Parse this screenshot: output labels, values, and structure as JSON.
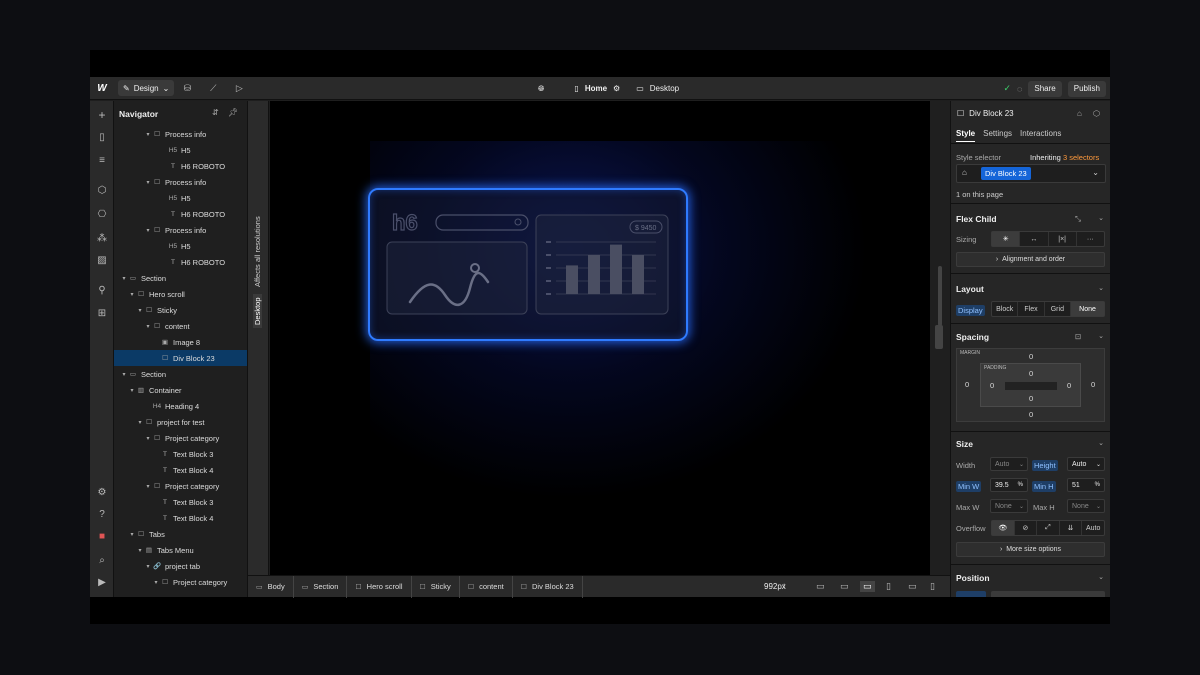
{
  "topbar": {
    "logo": "W",
    "mode_label": "Design",
    "page_name": "Home",
    "breakpoint_label": "Desktop",
    "share_label": "Share",
    "publish_label": "Publish",
    "status_color": "#3ccf6b"
  },
  "navigator": {
    "title": "Navigator",
    "rows": [
      {
        "label": "Process info",
        "icon": "box-icon",
        "icon_char": "☐",
        "depth": 3,
        "caret": "▾"
      },
      {
        "label": "H5",
        "icon": "h5-icon",
        "icon_char": "H5",
        "depth": 5,
        "caret": ""
      },
      {
        "label": "H6 ROBOTO",
        "icon": "text-icon",
        "icon_char": "T",
        "depth": 5,
        "caret": ""
      },
      {
        "label": "Process info",
        "icon": "box-icon",
        "icon_char": "☐",
        "depth": 3,
        "caret": "▾"
      },
      {
        "label": "H5",
        "icon": "h5-icon",
        "icon_char": "H5",
        "depth": 5,
        "caret": ""
      },
      {
        "label": "H6 ROBOTO",
        "icon": "text-icon",
        "icon_char": "T",
        "depth": 5,
        "caret": ""
      },
      {
        "label": "Process info",
        "icon": "box-icon",
        "icon_char": "☐",
        "depth": 3,
        "caret": "▾"
      },
      {
        "label": "H5",
        "icon": "h5-icon",
        "icon_char": "H5",
        "depth": 5,
        "caret": ""
      },
      {
        "label": "H6 ROBOTO",
        "icon": "text-icon",
        "icon_char": "T",
        "depth": 5,
        "caret": ""
      },
      {
        "label": "Section",
        "icon": "section-icon",
        "icon_char": "▭",
        "depth": 0,
        "caret": "▾"
      },
      {
        "label": "Hero scroll",
        "icon": "box-icon",
        "icon_char": "☐",
        "depth": 1,
        "caret": "▾"
      },
      {
        "label": "Sticky",
        "icon": "box-icon",
        "icon_char": "☐",
        "depth": 2,
        "caret": "▾"
      },
      {
        "label": "content",
        "icon": "box-icon",
        "icon_char": "☐",
        "depth": 3,
        "caret": "▾"
      },
      {
        "label": "Image 8",
        "icon": "image-icon",
        "icon_char": "▣",
        "depth": 4,
        "caret": ""
      },
      {
        "label": "Div Block 23",
        "icon": "box-icon",
        "icon_char": "☐",
        "depth": 4,
        "caret": "",
        "selected": true
      },
      {
        "label": "Section",
        "icon": "section-icon",
        "icon_char": "▭",
        "depth": 0,
        "caret": "▾"
      },
      {
        "label": "Container",
        "icon": "container-icon",
        "icon_char": "▥",
        "depth": 1,
        "caret": "▾"
      },
      {
        "label": "Heading 4",
        "icon": "h4-icon",
        "icon_char": "H4",
        "depth": 3,
        "caret": ""
      },
      {
        "label": "project for test",
        "icon": "box-icon",
        "icon_char": "☐",
        "depth": 2,
        "caret": "▾"
      },
      {
        "label": "Project category",
        "icon": "box-icon",
        "icon_char": "☐",
        "depth": 3,
        "caret": "▾"
      },
      {
        "label": "Text Block 3",
        "icon": "text-icon",
        "icon_char": "T",
        "depth": 4,
        "caret": ""
      },
      {
        "label": "Text Block 4",
        "icon": "text-icon",
        "icon_char": "T",
        "depth": 4,
        "caret": ""
      },
      {
        "label": "Project category",
        "icon": "box-icon",
        "icon_char": "☐",
        "depth": 3,
        "caret": "▾"
      },
      {
        "label": "Text Block 3",
        "icon": "text-icon",
        "icon_char": "T",
        "depth": 4,
        "caret": ""
      },
      {
        "label": "Text Block 4",
        "icon": "text-icon",
        "icon_char": "T",
        "depth": 4,
        "caret": ""
      },
      {
        "label": "Tabs",
        "icon": "tabs-icon",
        "icon_char": "☐",
        "depth": 1,
        "caret": "▾"
      },
      {
        "label": "Tabs Menu",
        "icon": "tabs-menu-icon",
        "icon_char": "▤",
        "depth": 2,
        "caret": "▾"
      },
      {
        "label": "project tab",
        "icon": "link-icon",
        "icon_char": "🔗",
        "depth": 3,
        "caret": "▾"
      },
      {
        "label": "Project category",
        "icon": "box-icon",
        "icon_char": "☐",
        "depth": 4,
        "caret": "▾"
      }
    ]
  },
  "vstrip": {
    "affects_label": "Affects all resolutions",
    "desktop_label": "Desktop"
  },
  "canvas": {
    "card": {
      "heading": "h6",
      "price": "$ 9450",
      "bar_values": [
        0.55,
        0.75,
        0.95,
        0.75
      ],
      "accent_color": "#2f7bff"
    }
  },
  "breadcrumbs": {
    "items": [
      {
        "label": "Body",
        "icon": "body-icon"
      },
      {
        "label": "Section",
        "icon": "section-icon"
      },
      {
        "label": "Hero scroll",
        "icon": "box-icon"
      },
      {
        "label": "Sticky",
        "icon": "box-icon"
      },
      {
        "label": "content",
        "icon": "box-icon"
      },
      {
        "label": "Div Block 23",
        "icon": "box-icon"
      }
    ],
    "width_label": "992px"
  },
  "panel": {
    "element_name": "Div Block 23",
    "tabs": [
      "Style",
      "Settings",
      "Interactions"
    ],
    "style_selector_label": "Style selector",
    "inheriting_prefix": "Inheriting",
    "inheriting_count": "3 selectors",
    "selector_chip": "Div Block 23",
    "on_page": "1 on this page",
    "flex_child": {
      "title": "Flex Child",
      "sizing_label": "Sizing",
      "alignment_button": "Alignment and order"
    },
    "layout": {
      "title": "Layout",
      "display_label": "Display",
      "options": [
        "Block",
        "Flex",
        "Grid",
        "None"
      ]
    },
    "spacing": {
      "title": "Spacing",
      "margin_label": "MARGIN",
      "padding_label": "PADDING",
      "margin_top": "0",
      "margin_right": "0",
      "margin_bottom": "0",
      "margin_left": "0",
      "padding_top": "0",
      "padding_right": "0",
      "padding_bottom": "0",
      "padding_left": "0"
    },
    "size": {
      "title": "Size",
      "width_label": "Width",
      "width_value": "Auto",
      "height_label": "Height",
      "height_value": "Auto",
      "min_w_label": "Min W",
      "min_w_value": "39.5",
      "min_w_unit": "%",
      "min_h_label": "Min H",
      "min_h_value": "51",
      "min_h_unit": "%",
      "max_w_label": "Max W",
      "max_w_value": "None",
      "max_h_label": "Max H",
      "max_h_value": "None",
      "overflow_label": "Overflow",
      "overflow_auto": "Auto",
      "more_button": "More size options"
    },
    "position": {
      "title": "Position"
    },
    "accent_orange": "#ff9a3c",
    "accent_blue": "#1565d8"
  }
}
